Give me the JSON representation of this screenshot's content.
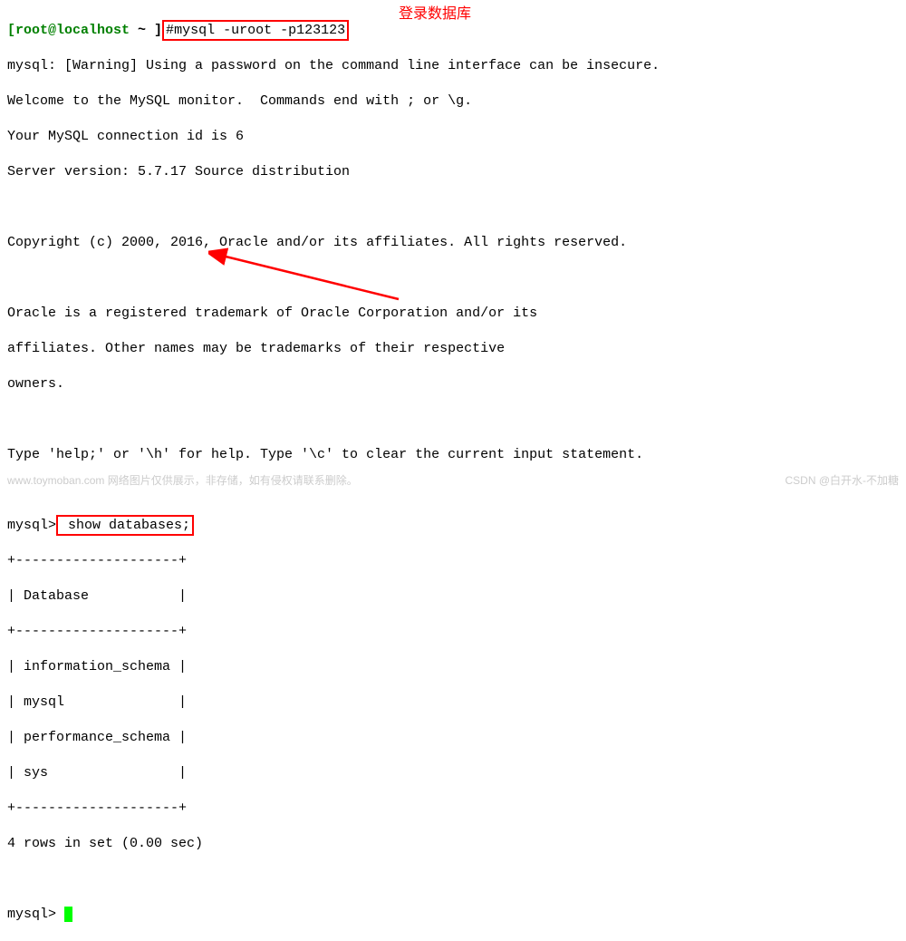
{
  "prompt": {
    "user_host": "[root@localhost ",
    "path": "~ ]",
    "hash": "#",
    "command": "mysql -uroot -p123123"
  },
  "annotation": {
    "login_db": "登录数据库"
  },
  "output": {
    "warning": "mysql: [Warning] Using a password on the command line interface can be insecure.",
    "welcome": "Welcome to the MySQL monitor.  Commands end with ; or \\g.",
    "connection": "Your MySQL connection id is 6",
    "version": "Server version: 5.7.17 Source distribution",
    "copyright": "Copyright (c) 2000, 2016, Oracle and/or its affiliates. All rights reserved.",
    "trademark1": "Oracle is a registered trademark of Oracle Corporation and/or its",
    "trademark2": "affiliates. Other names may be trademarks of their respective",
    "trademark3": "owners.",
    "help": "Type 'help;' or '\\h' for help. Type '\\c' to clear the current input statement."
  },
  "query": {
    "prompt": "mysql>",
    "command": " show databases;"
  },
  "table": {
    "border": "+--------------------+",
    "header": "| Database           |",
    "row1": "| information_schema |",
    "row2": "| mysql              |",
    "row3": "| performance_schema |",
    "row4": "| sys                |",
    "footer": "4 rows in set (0.00 sec)"
  },
  "final_prompt": {
    "text": "mysql> "
  },
  "watermark": {
    "left": "www.toymoban.com  网络图片仅供展示，非存储，如有侵权请联系删除。",
    "right": "CSDN @白开水-不加糖"
  }
}
